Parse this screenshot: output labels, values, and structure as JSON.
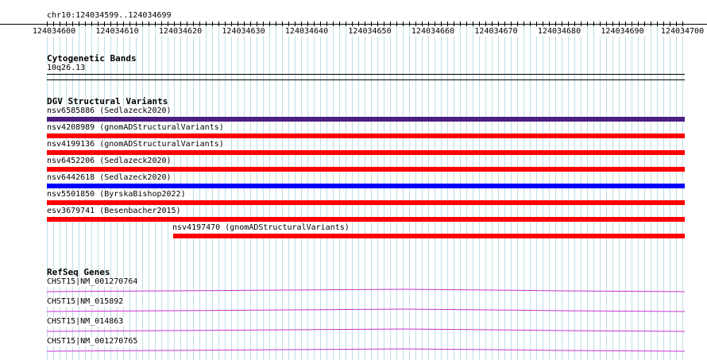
{
  "ruler": {
    "region": "chr10:124034599..124034699",
    "ticks": [
      "124034600",
      "124034610",
      "124034620",
      "124034630",
      "124034640",
      "124034650",
      "124034660",
      "124034670",
      "124034680",
      "124034690",
      "124034700"
    ]
  },
  "cytoband": {
    "title": "Cytogenetic Bands",
    "band": "10q26.13"
  },
  "dgv": {
    "title": "DGV Structural Variants",
    "variants": [
      {
        "label": "nsv6585886 (Sedlazeck2020)",
        "color": "#4b1e7f"
      },
      {
        "label": "nsv4208989 (gnomADStructuralVariants)",
        "color": "#ff0000"
      },
      {
        "label": "nsv4199136 (gnomADStructuralVariants)",
        "color": "#ff0000"
      },
      {
        "label": "nsv6452206 (Sedlazeck2020)",
        "color": "#ff0000"
      },
      {
        "label": "nsv6442618 (Sedlazeck2020)",
        "color": "#0000ff"
      },
      {
        "label": "nsv5501850 (ByrskaBishop2022)",
        "color": "#ff0000"
      },
      {
        "label": "esv3679741 (Besenbacher2015)",
        "color": "#ff0000"
      },
      {
        "label": "nsv4197470 (gnomADStructuralVariants)",
        "color": "#ff0000"
      }
    ]
  },
  "refseq": {
    "title": "RefSeq Genes",
    "genes": [
      {
        "label": "CHST15|NM_001270764",
        "color": "#cc33cc"
      },
      {
        "label": "CHST15|NM_015892",
        "color": "#cc33cc"
      },
      {
        "label": "CHST15|NM_014863",
        "color": "#cc33cc"
      },
      {
        "label": "CHST15|NM_001270765",
        "color": "#cc33cc"
      }
    ]
  }
}
